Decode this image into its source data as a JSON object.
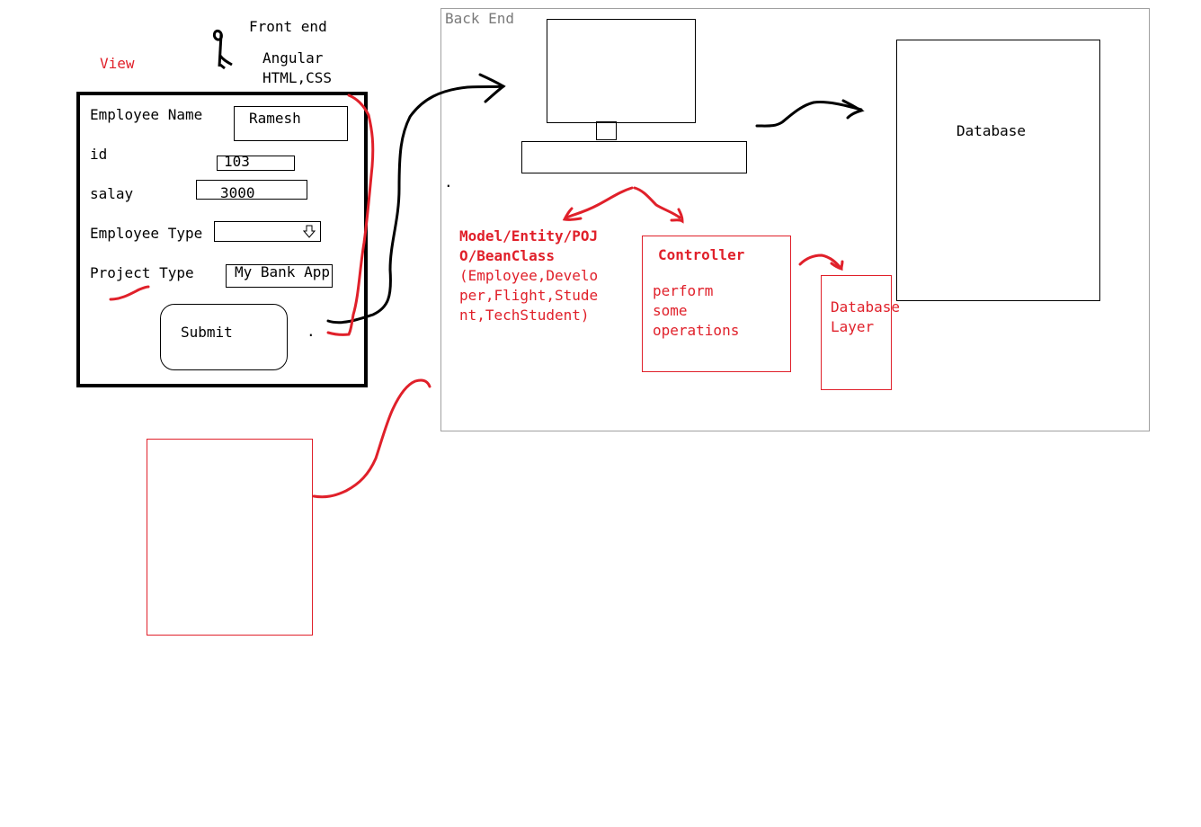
{
  "frontend": {
    "title": "Front end",
    "tech_line1": "Angular",
    "tech_line2": "HTML,CSS",
    "view_label": "View"
  },
  "form": {
    "employee_name_label": "Employee Name",
    "employee_name_value": "Ramesh",
    "id_label": "id",
    "id_value": "103",
    "salary_label": "salay",
    "salary_value": "3000",
    "employee_type_label": "Employee Type",
    "employee_type_value": "",
    "project_type_label": "Project Type",
    "project_type_value": "My Bank App",
    "submit_label": "Submit",
    "dot": "."
  },
  "backend": {
    "title": "Back End",
    "dot": ".",
    "model_title_line1": "Model/Entity/POJ",
    "model_title_line2": "O/BeanClass",
    "model_desc_line1": "(Employee,Develo",
    "model_desc_line2": "per,Flight,Stude",
    "model_desc_line3": "nt,TechStudent)",
    "controller_title": "Controller",
    "controller_line1": "perform",
    "controller_line2": "some",
    "controller_line3": "operations",
    "db_layer_line1": "Database",
    "db_layer_line2": "Layer",
    "database_label": "Database"
  },
  "colors": {
    "accent_red": "#e0202a",
    "ink": "#000000",
    "label_grey": "#7a7a7a"
  },
  "icons": [
    "stick-figure-icon",
    "dropdown-arrow-icon",
    "computer-monitor-icon"
  ]
}
